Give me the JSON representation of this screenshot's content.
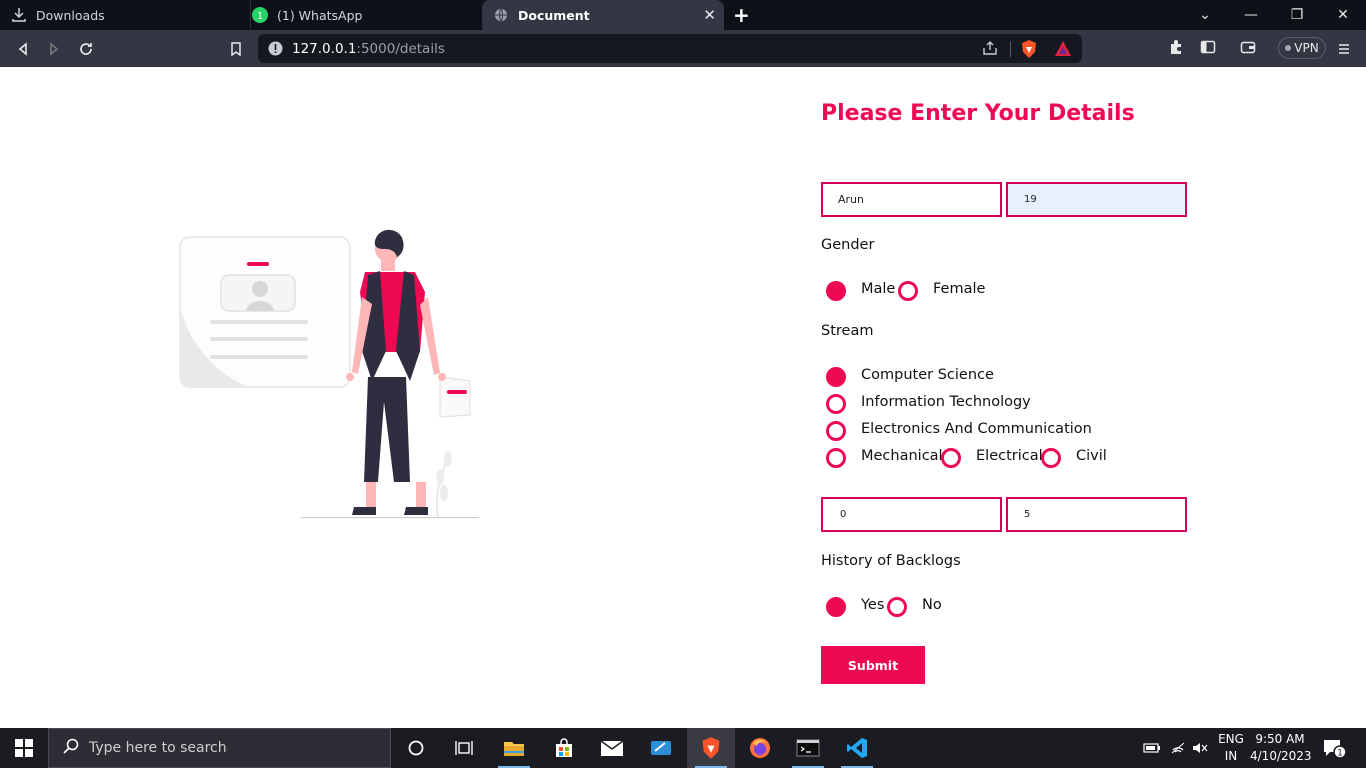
{
  "browser": {
    "tabs": [
      {
        "label": "Downloads",
        "icon": "download-icon"
      },
      {
        "label": "(1) WhatsApp",
        "icon": "whatsapp-icon",
        "badge": "1"
      },
      {
        "label": "Document",
        "icon": "globe-icon",
        "active": true
      }
    ],
    "new_tab": "+",
    "url_host": "127.0.0.1",
    "url_path": ":5000/details",
    "vpn_label": "VPN"
  },
  "form": {
    "title": "Please Enter Your Details",
    "name_value": "Arun",
    "age_value": "19",
    "gender_label": "Gender",
    "gender_options": [
      {
        "label": "Male",
        "selected": true
      },
      {
        "label": "Female",
        "selected": false
      }
    ],
    "stream_label": "Stream",
    "stream_options": [
      {
        "label": "Computer Science",
        "selected": true
      },
      {
        "label": "Information Technology",
        "selected": false
      },
      {
        "label": "Electronics And Communication",
        "selected": false
      },
      {
        "label": "Mechanical",
        "selected": false
      },
      {
        "label": "Electrical",
        "selected": false
      },
      {
        "label": "Civil",
        "selected": false
      }
    ],
    "field_a_value": "0",
    "field_b_value": "5",
    "backlogs_label": "History of Backlogs",
    "backlog_options": [
      {
        "label": "Yes",
        "selected": true
      },
      {
        "label": "No",
        "selected": false
      }
    ],
    "submit_label": "Submit"
  },
  "taskbar": {
    "search_placeholder": "Type here to search",
    "lang_top": "ENG",
    "lang_bottom": "IN",
    "time": "9:50 AM",
    "date": "4/10/2023",
    "notification_count": "1"
  },
  "colors": {
    "accent": "#ee0a53",
    "field_border": "#d6005a"
  }
}
